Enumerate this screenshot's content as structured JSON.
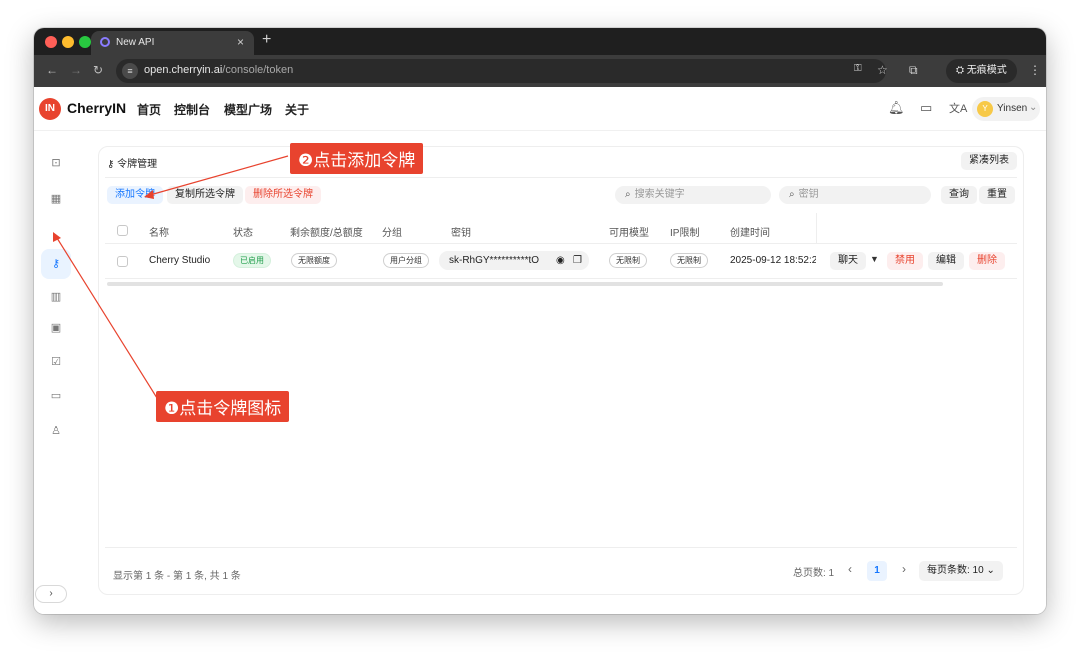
{
  "browser": {
    "tab_title": "New API",
    "tab_close": "×",
    "new_tab": "+",
    "url_host": "open.cherryin.ai",
    "url_path": "/console/token",
    "incognito_label": "无痕模式"
  },
  "header": {
    "logo_text": "IN",
    "brand": "CherryIN",
    "menu": [
      "首页",
      "控制台",
      "模型广场",
      "关于"
    ],
    "user_initial": "Y",
    "user_name": "Yinsen"
  },
  "card": {
    "title": "令牌管理",
    "compact_list": "紧凑列表",
    "add_token": "添加令牌",
    "copy_selected": "复制所选令牌",
    "delete_selected": "删除所选令牌",
    "search_keyword_placeholder": "搜索关键字",
    "search_key_placeholder": "密钥",
    "query": "查询",
    "reset": "重置"
  },
  "table": {
    "columns": [
      "名称",
      "状态",
      "剩余额度/总额度",
      "分组",
      "密钥",
      "可用模型",
      "IP限制",
      "创建时间"
    ],
    "rows": [
      {
        "name": "Cherry Studio",
        "status": "已启用",
        "quota": "无限额度",
        "group": "用户分组",
        "key": "sk-RhGY**********tO",
        "models": "无限制",
        "ip": "无限制",
        "created": "2025-09-12 18:52:2",
        "actions": {
          "chat": "聊天",
          "disable": "禁用",
          "edit": "编辑",
          "delete": "删除"
        }
      }
    ]
  },
  "footer": {
    "summary": "显示第 1 条 - 第 1 条, 共 1 条",
    "total_pages": "总页数: 1",
    "current_page": "1",
    "page_size": "每页条数: 10"
  },
  "annotations": {
    "step1": "❶点击令牌图标",
    "step2": "❷点击添加令牌"
  },
  "colors": {
    "accent": "#1677ff",
    "danger": "#e8432e",
    "success": "#1f9d4a",
    "chrome_dark": "#1f1f1f"
  }
}
